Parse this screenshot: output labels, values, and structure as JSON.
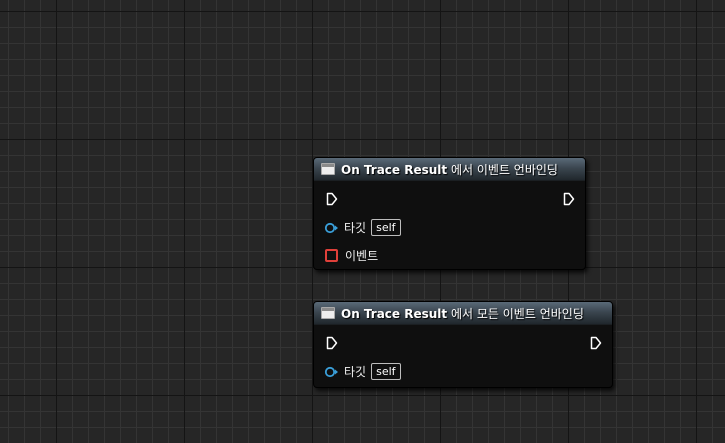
{
  "nodes": [
    {
      "id": "unbind-event",
      "title_bold": "On Trace Result",
      "title_rest": " 에서 이벤트 언바인딩",
      "target_label": "타깃",
      "target_value": "self",
      "event_label": "이벤트"
    },
    {
      "id": "unbind-all-events",
      "title_bold": "On Trace Result",
      "title_rest": " 에서 모든 이벤트 언바인딩",
      "target_label": "타깃",
      "target_value": "self"
    }
  ],
  "colors": {
    "canvas_bg": "#262626",
    "object_pin": "#3a9fd9",
    "delegate_pin": "#e0403a",
    "exec_pin": "#ffffff"
  }
}
